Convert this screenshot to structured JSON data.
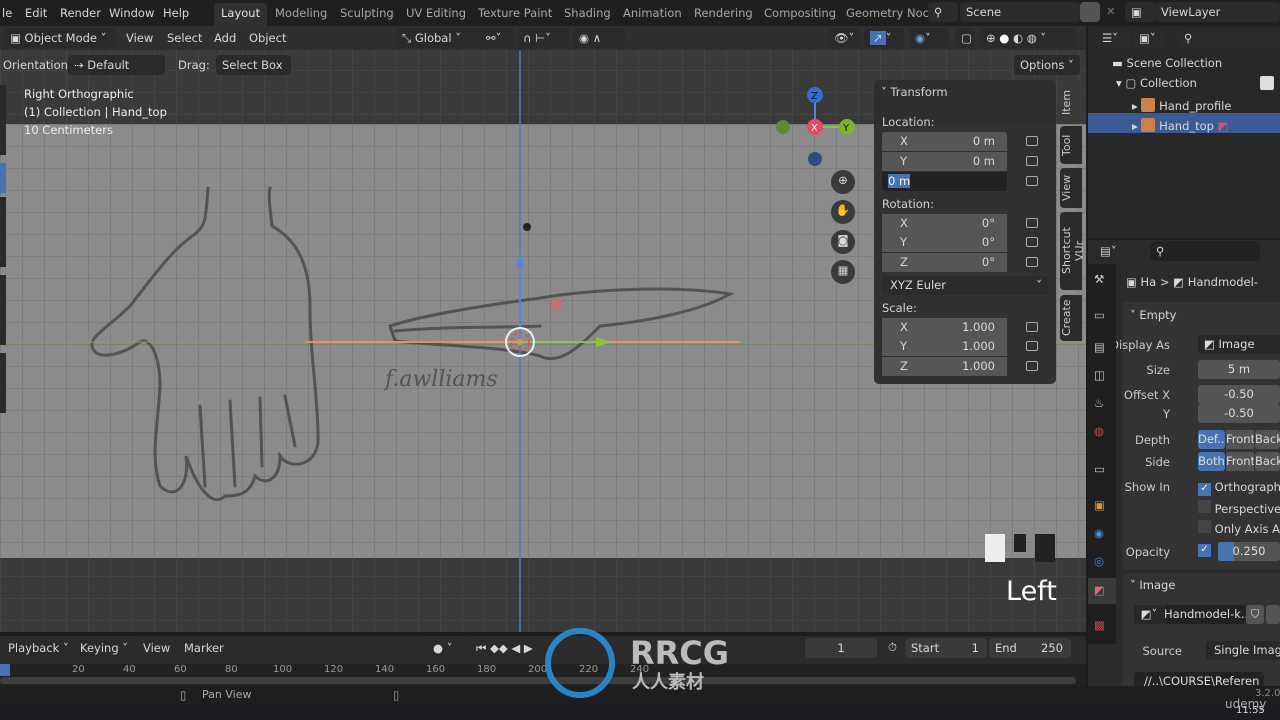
{
  "menu": [
    "le",
    "Edit",
    "Render",
    "Window",
    "Help"
  ],
  "workspaces": [
    "Layout",
    "Modeling",
    "Sculpting",
    "UV Editing",
    "Texture Paint",
    "Shading",
    "Animation",
    "Rendering",
    "Compositing",
    "Geometry Noc"
  ],
  "scene": "Scene",
  "view_layer": "ViewLayer",
  "header": {
    "mode": "Object Mode",
    "view": "View",
    "select": "Select",
    "add": "Add",
    "object": "Object",
    "orientation_global": "Global",
    "options": "Options"
  },
  "tool_settings": {
    "orientation_label": "Orientation:",
    "orientation": "Default",
    "drag_label": "Drag:",
    "drag": "Select Box"
  },
  "viewport": {
    "view_name": "Right Orthographic",
    "collection": "(1) Collection | Hand_top",
    "scale": "10 Centimeters",
    "key_overlay": "Left",
    "gizmo": {
      "z": "Z",
      "x": "X",
      "y": "Y"
    }
  },
  "transform": {
    "title": "Transform",
    "location_label": "Location:",
    "location": [
      {
        "axis": "X",
        "value": "0 m"
      },
      {
        "axis": "Y",
        "value": "0 m"
      },
      {
        "axis": "Z",
        "value": "0 m"
      }
    ],
    "rotation_label": "Rotation:",
    "rotation": [
      {
        "axis": "X",
        "value": "0°"
      },
      {
        "axis": "Y",
        "value": "0°"
      },
      {
        "axis": "Z",
        "value": "0°"
      }
    ],
    "rotation_mode": "XYZ Euler",
    "scale_label": "Scale:",
    "scale": [
      {
        "axis": "X",
        "value": "1.000"
      },
      {
        "axis": "Y",
        "value": "1.000"
      },
      {
        "axis": "Z",
        "value": "1.000"
      }
    ]
  },
  "sidebar_tabs": [
    "Item",
    "Tool",
    "View",
    "Shortcut VUr",
    "Create"
  ],
  "outliner": {
    "scene_collection": "Scene Collection",
    "collection": "Collection",
    "items": [
      "Hand_profile",
      "Hand_top"
    ]
  },
  "properties": {
    "breadcrumb_object": "Ha",
    "breadcrumb_data": "Handmodel-",
    "empty_section": "Empty",
    "display_as_label": "Display As",
    "display_as": "Image",
    "size_label": "Size",
    "size": "5 m",
    "offset_x_label": "Offset X",
    "offset_x": "-0.50",
    "offset_y_label": "Y",
    "offset_y": "-0.50",
    "depth_label": "Depth",
    "depth": [
      "Def...",
      "Front",
      "Back"
    ],
    "side_label": "Side",
    "side": [
      "Both",
      "Front",
      "Back"
    ],
    "show_in_label": "Show In",
    "show_in": [
      {
        "label": "Orthographic",
        "checked": true
      },
      {
        "label": "Perspective",
        "checked": false
      },
      {
        "label": "Only Axis Al...",
        "checked": false
      }
    ],
    "opacity_label": "Opacity",
    "opacity": "0.250",
    "opacity_fraction": 0.25,
    "image_section": "Image",
    "image_name": "Handmodel-k...",
    "source_label": "Source",
    "source": "Single Image",
    "filepath": "//..\\COURSE\\Referen"
  },
  "timeline": {
    "playback": "Playback",
    "keying": "Keying",
    "view": "View",
    "marker": "Marker",
    "current_frame": "1",
    "start_label": "Start",
    "start": "1",
    "end_label": "End",
    "end": "250",
    "ticks": [
      "20",
      "40",
      "60",
      "80",
      "100",
      "120",
      "140",
      "160",
      "180",
      "200",
      "220",
      "240"
    ]
  },
  "status": {
    "pan_view": "Pan View",
    "version": "3.2.0"
  },
  "watermark": {
    "brand": "RRCG",
    "sub": "人人素材",
    "udemy": "udemy"
  },
  "clock": "11:55",
  "colors": {
    "accent": "#4772b3",
    "x_axis": "#e84b5f",
    "y_axis": "#8bc43f",
    "z_axis": "#4b8ad8",
    "selection": "#e6953d"
  }
}
